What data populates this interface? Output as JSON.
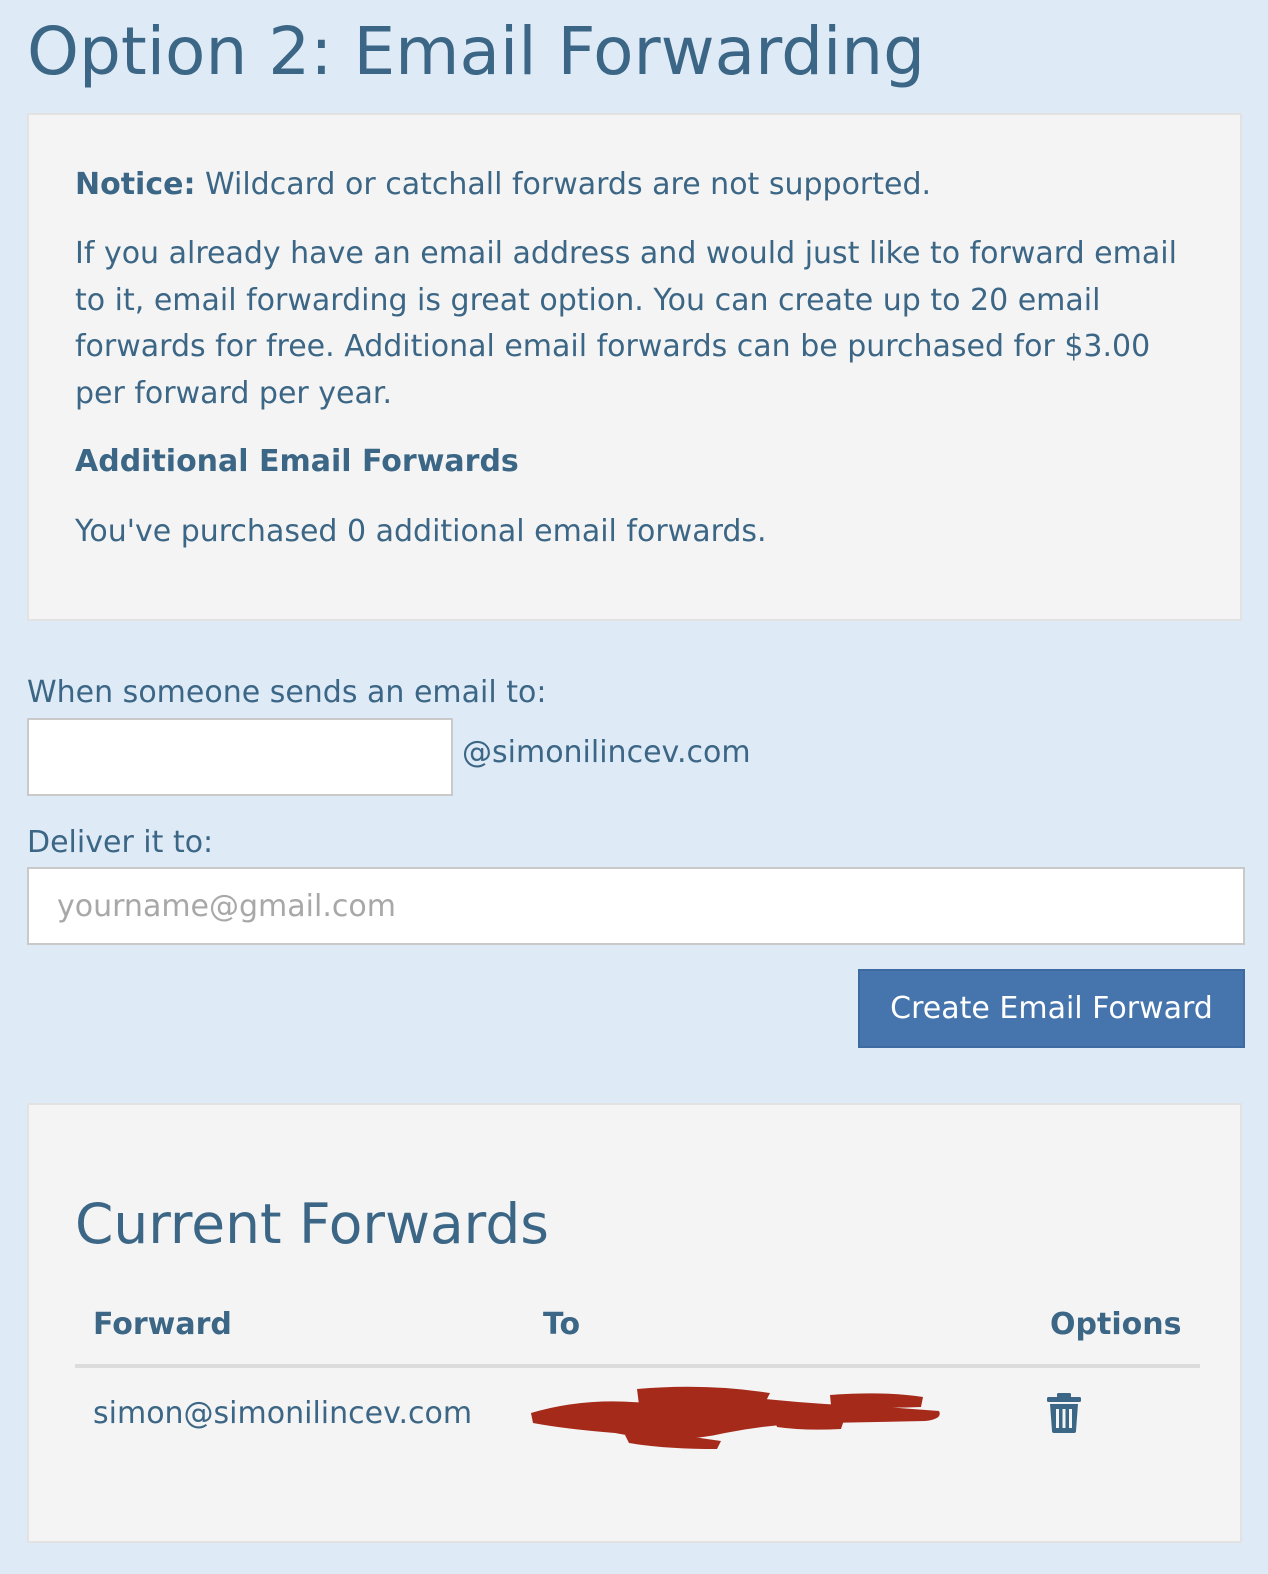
{
  "page": {
    "title": "Option 2: Email Forwarding"
  },
  "notice": {
    "label": "Notice:",
    "text": " Wildcard or catchall forwards are not supported.",
    "intro": "If you already have an email address and would just like to forward email to it, email forwarding is great option. You can create up to 20 email forwards for free. Additional email forwards can be purchased for $3.00 per forward per year.",
    "additional_heading": "Additional Email Forwards",
    "purchased_text": "You've purchased 0 additional email forwards."
  },
  "form": {
    "source_label": "When someone sends an email to:",
    "source_value": "",
    "domain_suffix": "@simonilincev.com",
    "deliver_label": "Deliver it to:",
    "deliver_value": "",
    "deliver_placeholder": "yourname@gmail.com",
    "submit_label": "Create Email Forward"
  },
  "forwards": {
    "title": "Current Forwards",
    "columns": [
      "Forward",
      "To",
      "Options"
    ],
    "rows": [
      {
        "forward": "simon@simonilincev.com",
        "to_redacted": true,
        "redaction_color": "#a52a1a",
        "option_icon": "trash-icon"
      }
    ]
  },
  "colors": {
    "background": "#deeaf6",
    "panel": "#f4f4f4",
    "text": "#3c6685",
    "primary_button": "#4674ad"
  }
}
